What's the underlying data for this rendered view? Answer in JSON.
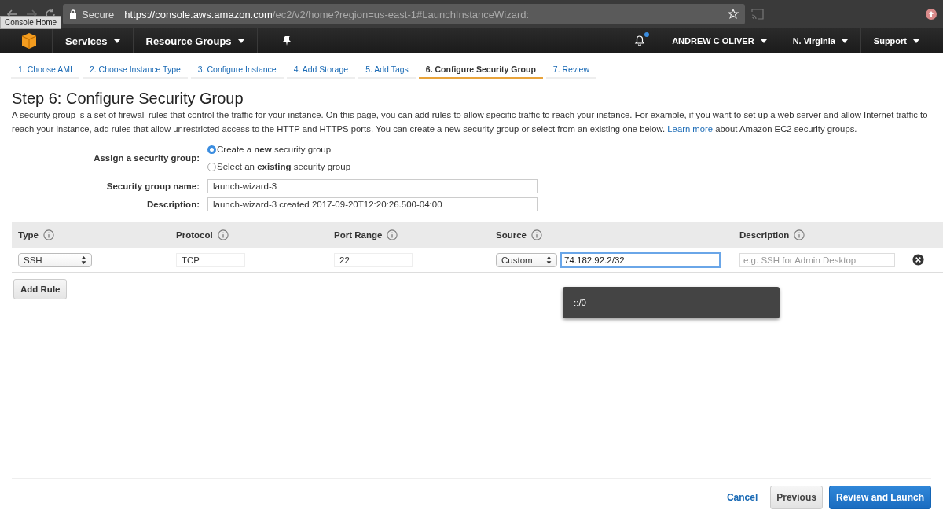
{
  "browser": {
    "secure_label": "Secure",
    "url_host": "https://console.aws.amazon.com",
    "url_path": "/ec2/v2/home?region=us-east-1#LaunchInstanceWizard:",
    "tooltip": "Console Home"
  },
  "nav": {
    "left": [
      {
        "label": "Services"
      },
      {
        "label": "Resource Groups"
      }
    ],
    "right": [
      {
        "label": "ANDREW C OLIVER"
      },
      {
        "label": "N. Virginia"
      },
      {
        "label": "Support"
      }
    ],
    "notification": true
  },
  "steps": [
    {
      "label": "1. Choose AMI",
      "selected": false
    },
    {
      "label": "2. Choose Instance Type",
      "selected": false
    },
    {
      "label": "3. Configure Instance",
      "selected": false
    },
    {
      "label": "4. Add Storage",
      "selected": false
    },
    {
      "label": "5. Add Tags",
      "selected": false
    },
    {
      "label": "6. Configure Security Group",
      "selected": true
    },
    {
      "label": "7. Review",
      "selected": false
    }
  ],
  "title": "Step 6: Configure Security Group",
  "intro": {
    "text": "A security group is a set of firewall rules that control the traffic for your instance. On this page, you can add rules to allow specific traffic to reach your instance. For example, if you want to set up a web server and allow Internet traffic to reach your instance, add rules that allow unrestricted access to the HTTP and HTTPS ports. You can create a new security group or select from an existing one below.",
    "link": "Learn more",
    "text_after": "about Amazon EC2 security groups."
  },
  "assign": {
    "label": "Assign a security group:",
    "options": [
      {
        "label": "Create a **new** security group",
        "selected": true
      },
      {
        "label": "Select an **existing** security group",
        "selected": false
      }
    ]
  },
  "fields": [
    {
      "label": "Security group name:",
      "value": "launch-wizard-3"
    },
    {
      "label": "Description:",
      "value": "launch-wizard-3 created 2017-09-20T12:20:26.500-04:00"
    }
  ],
  "table": {
    "columns": [
      "Type",
      "Protocol",
      "Port Range",
      "Source",
      "Description"
    ],
    "rows": [
      {
        "type": "SSH",
        "protocol": "TCP",
        "port_range": "22",
        "source": "Custom",
        "cidr": "74.182.92.2/32",
        "description_placeholder": "e.g. SSH for Admin Desktop"
      }
    ]
  },
  "add_rule": "Add Rule",
  "suggestion": "::/0",
  "footer": {
    "cancel": "Cancel",
    "previous": "Previous",
    "primary": "Review and Launch"
  }
}
